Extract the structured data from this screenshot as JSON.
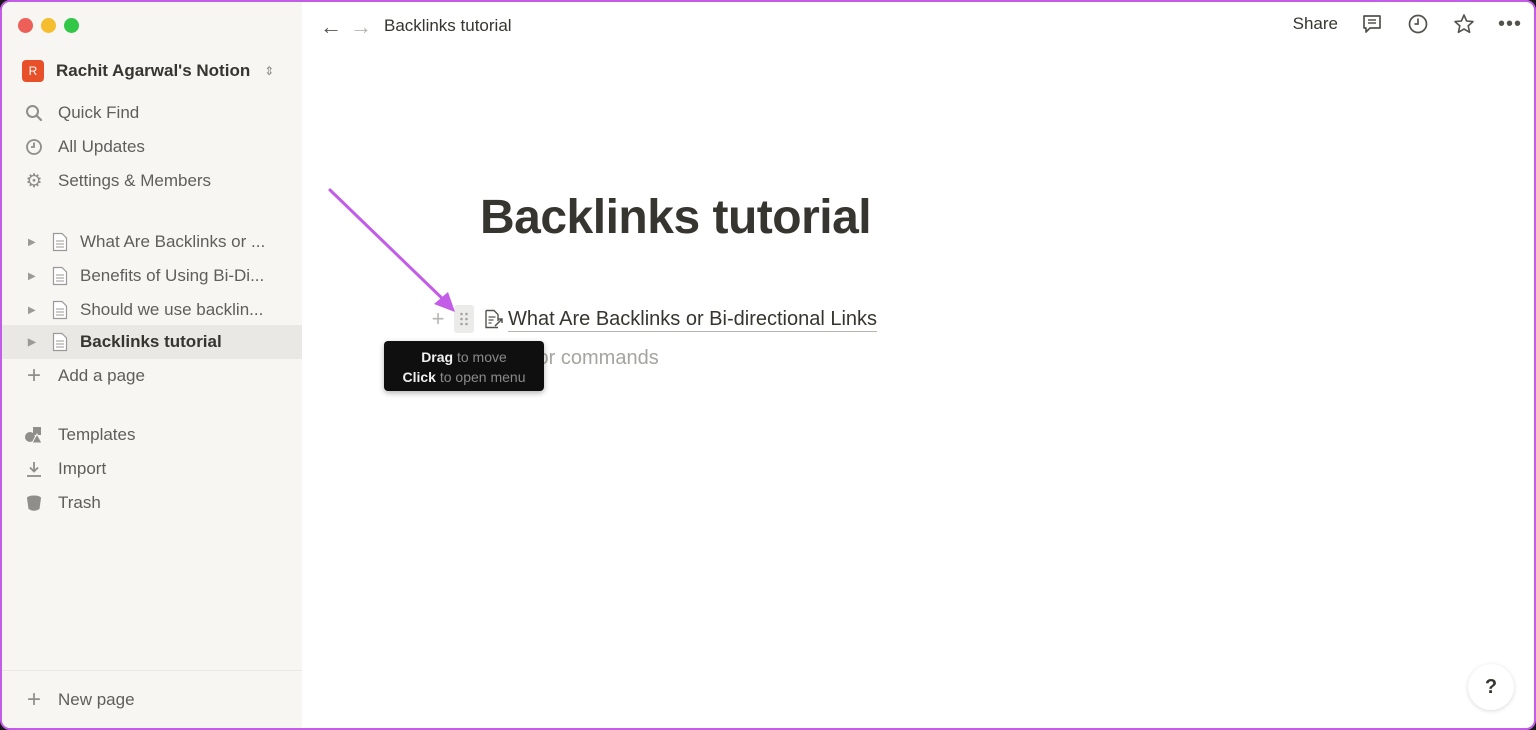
{
  "window": {
    "title": "Backlinks tutorial"
  },
  "sidebar": {
    "workspace": {
      "initial": "R",
      "name": "Rachit Agarwal's Notion"
    },
    "nav": [
      {
        "label": "Quick Find",
        "icon": "search-icon"
      },
      {
        "label": "All Updates",
        "icon": "clock-icon"
      },
      {
        "label": "Settings & Members",
        "icon": "gear-icon"
      }
    ],
    "pages": [
      {
        "label": "What Are Backlinks or ...",
        "active": false
      },
      {
        "label": "Benefits of Using Bi-Di...",
        "active": false
      },
      {
        "label": "Should we use backlin...",
        "active": false
      },
      {
        "label": "Backlinks tutorial",
        "active": true
      }
    ],
    "add_page": "Add a page",
    "tools": [
      {
        "label": "Templates",
        "icon": "templates-icon"
      },
      {
        "label": "Import",
        "icon": "import-icon"
      },
      {
        "label": "Trash",
        "icon": "trash-icon"
      }
    ],
    "new_page": "New page"
  },
  "topbar": {
    "breadcrumb": "Backlinks tutorial",
    "share": "Share"
  },
  "page": {
    "title": "Backlinks tutorial",
    "link_block": "What Are Backlinks or Bi-directional Links",
    "placeholder": "for commands",
    "tooltip": {
      "line1_bold": "Drag",
      "line1_rest": " to move",
      "line2_bold": "Click",
      "line2_rest": " to open menu"
    }
  },
  "help": "?",
  "colors": {
    "accent_annotation": "#c35ce6",
    "workspace_avatar": "#e8502a"
  }
}
